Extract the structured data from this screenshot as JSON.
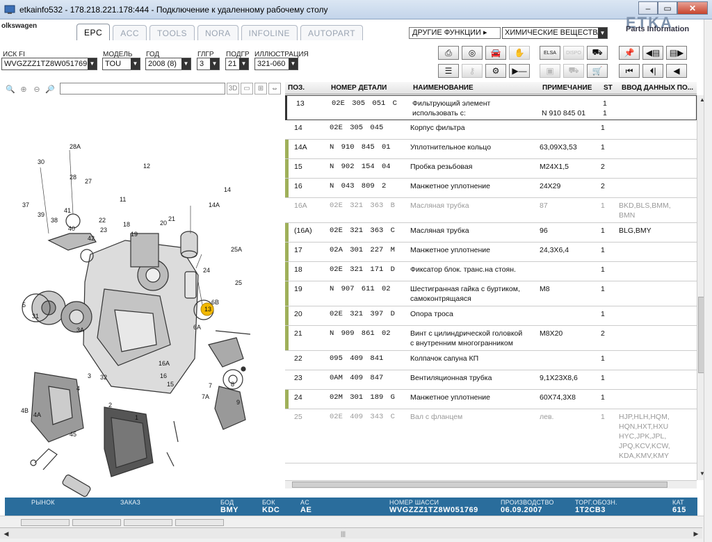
{
  "window": {
    "title": "etkainfo532 - 178.218.221.178:444 - Подключение к удаленному рабочему столу"
  },
  "header": {
    "brand": "olkswagen",
    "tabs": [
      "EPC",
      "ACC",
      "TOOLS",
      "NORA",
      "INFOLINE",
      "AUTOPART"
    ],
    "active_tab": "EPC",
    "other_functions": "ДРУГИЕ ФУНКЦИИ ▸",
    "chem_select": "ХИМИЧЕСКИЕ ВЕЩЕСТВА",
    "logo_text": "Parts Information"
  },
  "selectors": {
    "vin_label": "ИСК FI",
    "vin_value": "WVGZZZ1TZ8W051769",
    "model_label": "МОДЕЛЬ",
    "model_value": "TOU",
    "year_label": "ГОД",
    "year_value": "2008 (8)",
    "mgroup_label": "ГЛГР",
    "mgroup_value": "3",
    "sgroup_label": "ПОДГР",
    "sgroup_value": "21",
    "illus_label": "ИЛЛЮСТРАЦИЯ",
    "illus_value": "321-060"
  },
  "toolbar": {
    "row1": [
      "print-icon",
      "disc-icon",
      "car-icon",
      "handshake-icon",
      "elsa-icon",
      "dispo-icon",
      "cart-in-icon",
      "pin-icon",
      "prev-page-icon",
      "next-page-icon"
    ],
    "row2": [
      "list-icon",
      "key-icon",
      "bike-icon",
      "play-dash-icon",
      "device-icon",
      "cart-pair-icon",
      "cart-icon",
      "first-icon",
      "prev-icon",
      "back-icon"
    ],
    "elsa_label": "ELSA",
    "dispo_label": "DISPO"
  },
  "left": {
    "btn_3d": "3D"
  },
  "table": {
    "columns": [
      "ПОЗ.",
      "НОМЕР ДЕТАЛИ",
      "НАИМЕНОВАНИЕ",
      "ПРИМЕЧАНИЕ",
      "ST",
      "ВВОД ДАННЫХ ПО..."
    ],
    "rows": [
      {
        "pos": "13",
        "part": "02E 305 051 C",
        "name": "Фильтрующий элемент\n      использовать с:",
        "note": "\nN  910 845 01",
        "st": "1\n1",
        "data": "",
        "state": "selected"
      },
      {
        "pos": "14",
        "part": "02E 305 045",
        "name": "Корпус фильтра",
        "note": "",
        "st": "1",
        "data": "",
        "state": "normal"
      },
      {
        "pos": "14A",
        "part": "N   910 845 01",
        "name": "Уплотнительное кольцо",
        "note": "63,09X3,53",
        "st": "1",
        "data": "",
        "state": "bar"
      },
      {
        "pos": "15",
        "part": "N   902 154 04",
        "name": "Пробка резьбовая",
        "note": "M24X1,5",
        "st": "2",
        "data": "",
        "state": "bar"
      },
      {
        "pos": "16",
        "part": "N   043 809 2",
        "name": "Манжетное уплотнение",
        "note": "24X29",
        "st": "2",
        "data": "",
        "state": "bar"
      },
      {
        "pos": "16A",
        "part": "02E 321 363 B",
        "name": "Масляная трубка",
        "note": "87",
        "st": "1",
        "data": "BKD,BLS,BMM,\nBMN",
        "state": "grey"
      },
      {
        "pos": "(16A)",
        "part": "02E 321 363 C",
        "name": "Масляная трубка",
        "note": "96",
        "st": "1",
        "data": "BLG,BMY",
        "state": "bar"
      },
      {
        "pos": "17",
        "part": "02A 301 227 M",
        "name": "Манжетное уплотнение",
        "note": "24,3X6,4",
        "st": "1",
        "data": "",
        "state": "bar"
      },
      {
        "pos": "18",
        "part": "02E 321 171 D",
        "name": "Фиксатор блок. транс.на стоян.",
        "note": "",
        "st": "1",
        "data": "",
        "state": "bar"
      },
      {
        "pos": "19",
        "part": "N   907 611 02",
        "name": "Шестигранная гайка с буртиком,\nсамоконтрящаяся",
        "note": "M8",
        "st": "1",
        "data": "",
        "state": "bar"
      },
      {
        "pos": "20",
        "part": "02E 321 397 D",
        "name": "Опора троса",
        "note": "",
        "st": "1",
        "data": "",
        "state": "bar"
      },
      {
        "pos": "21",
        "part": "N   909 861 02",
        "name": "Винт с цилиндрической головкой\nс внутренним многогранником",
        "note": "M8X20",
        "st": "2",
        "data": "",
        "state": "bar"
      },
      {
        "pos": "22",
        "part": "095 409 841",
        "name": "Колпачок сапуна КП",
        "note": "",
        "st": "1",
        "data": "",
        "state": "normal"
      },
      {
        "pos": "23",
        "part": "0AM 409 847",
        "name": "Вентиляционная трубка",
        "note": "9,1X23X8,6",
        "st": "1",
        "data": "",
        "state": "normal"
      },
      {
        "pos": "24",
        "part": "02M 301 189 G",
        "name": "Манжетное уплотнение",
        "note": "60X74,3X8",
        "st": "1",
        "data": "",
        "state": "bar"
      },
      {
        "pos": "25",
        "part": "02E 409 343 C",
        "name": "Вал с фланцем",
        "note": "лев.",
        "st": "1",
        "data": "HJP,HLH,HQM,\nHQN,HXT,HXU\nHYC,JPK,JPL,\nJPQ,KCV,KCW,\nKDA,KMV,KMY",
        "state": "grey"
      }
    ]
  },
  "status": {
    "market_label": "РЫНОК",
    "order_label": "ЗАКАЗ",
    "bod_label": "БОД",
    "bod_value": "BMY",
    "bok_label": "БОК",
    "bok_value": "KDC",
    "ac_label": "AC",
    "ac_value": "AE",
    "vin_label": "НОМЕР ШАССИ",
    "vin_value": "WVGZZZ1TZ8W051769",
    "prod_label": "ПРОИЗВОДСТВО",
    "prod_value": "06.09.2007",
    "trade_label": "ТОРГ.ОБОЗН.",
    "trade_value": "1T2CB3",
    "cat_label": "КАТ",
    "cat_value": "615"
  },
  "illustration": {
    "labels": [
      "28A",
      "30",
      "28",
      "27",
      "12",
      "11",
      "14",
      "14A",
      "13",
      "37",
      "39",
      "38",
      "41",
      "40",
      "42",
      "22",
      "23",
      "18",
      "19",
      "20",
      "21",
      "25A",
      "24",
      "25",
      "6B",
      "5",
      "31",
      "3A",
      "3",
      "32",
      "16A",
      "16",
      "15",
      "6A",
      "7",
      "7A",
      "8",
      "9",
      "4",
      "4B",
      "4A",
      "45",
      "2",
      "1"
    ],
    "highlight": "13"
  },
  "colors": {
    "status_bg": "#2a6d9c",
    "row_bar": "#9fb05a",
    "highlight": "#f2b800"
  }
}
